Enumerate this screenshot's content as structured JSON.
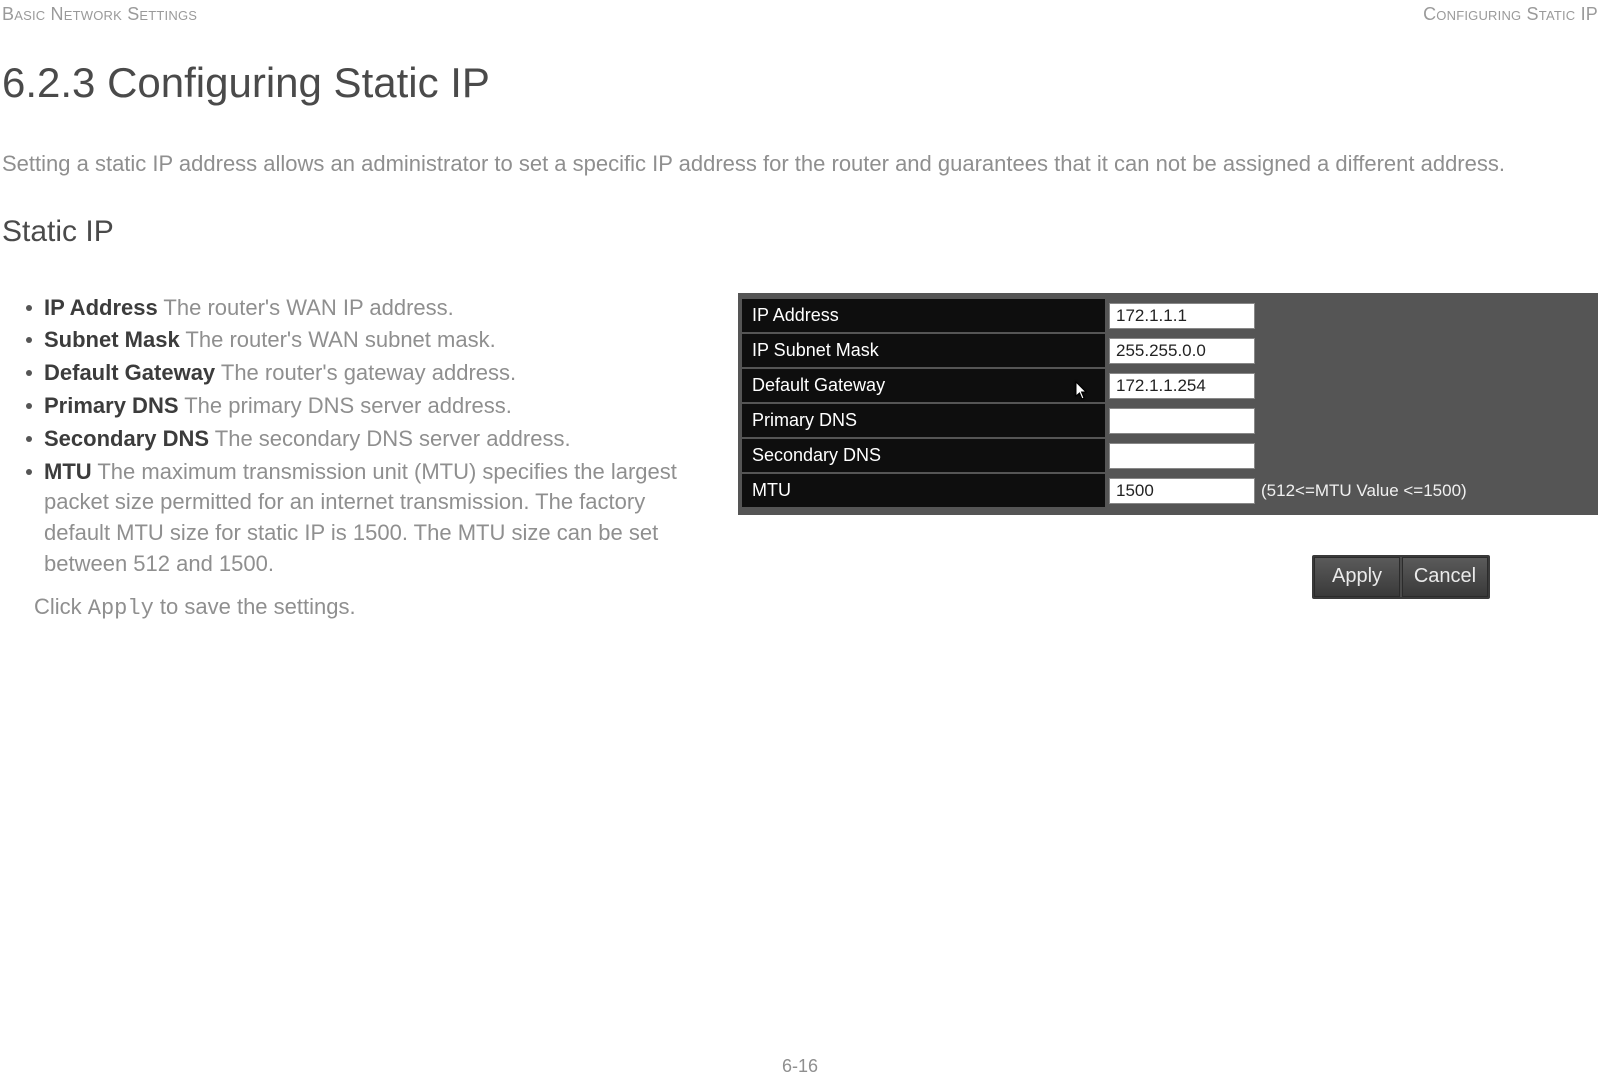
{
  "header": {
    "left": "Basic Network Settings",
    "right": "Configuring Static IP"
  },
  "heading": "6.2.3 Configuring Static IP",
  "intro": "Setting a static IP address allows an administrator to set a specific IP address for the router and guarantees that it can not be assigned a different address.",
  "subheading": "Static IP",
  "definitions": [
    {
      "term": "IP Address",
      "desc": "  The router's WAN IP address."
    },
    {
      "term": "Subnet Mask",
      "desc": "  The router's WAN subnet mask."
    },
    {
      "term": "Default Gateway",
      "desc": "  The router's gateway address."
    },
    {
      "term": "Primary DNS",
      "desc": " The primary DNS server address."
    },
    {
      "term": "Secondary DNS",
      "desc": "  The secondary DNS server address."
    },
    {
      "term": "MTU",
      "desc": "  The maximum transmission unit (MTU) specifies the largest packet size permitted for an internet transmission. The factory default MTU size for static IP is 1500. The MTU size can be set between 512 and 1500."
    }
  ],
  "apply_text_pre": "Click ",
  "apply_text_code": "Apply",
  "apply_text_post": " to save the settings.",
  "panel": {
    "rows": [
      {
        "label": "IP Address",
        "value": "172.1.1.1",
        "hint": ""
      },
      {
        "label": "IP Subnet Mask",
        "value": "255.255.0.0",
        "hint": ""
      },
      {
        "label": "Default Gateway",
        "value": "172.1.1.254",
        "hint": "",
        "cursor": true
      },
      {
        "label": "Primary DNS",
        "value": "",
        "hint": ""
      },
      {
        "label": "Secondary DNS",
        "value": "",
        "hint": ""
      },
      {
        "label": "MTU",
        "value": "1500",
        "hint": "(512<=MTU Value <=1500)"
      }
    ]
  },
  "buttons": {
    "apply": "Apply",
    "cancel": "Cancel"
  },
  "page_number": "6-16"
}
